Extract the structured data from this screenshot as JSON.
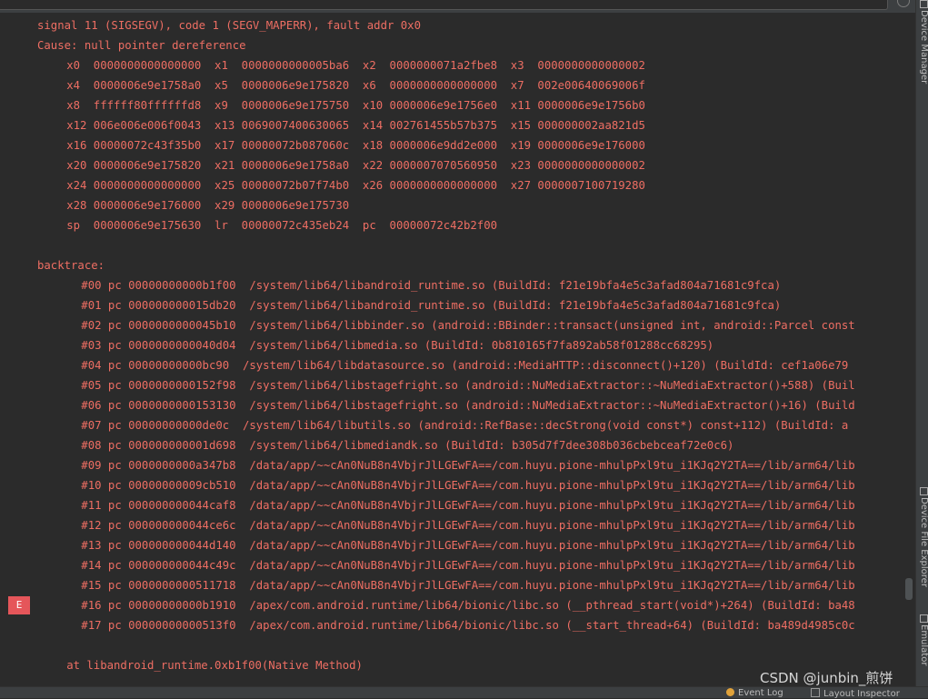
{
  "colors": {
    "log_error": "#ee6e63",
    "background": "#2b2b2b",
    "panel": "#3c3f41",
    "badge": "#e5565a"
  },
  "log_lines": [
    {
      "indent": 0,
      "text": "signal 11 (SIGSEGV), code 1 (SEGV_MAPERR), fault addr 0x0"
    },
    {
      "indent": 0,
      "text": "Cause: null pointer dereference"
    },
    {
      "indent": 4,
      "text": "x0  0000000000000000  x1  0000000000005ba6  x2  0000000071a2fbe8  x3  0000000000000002"
    },
    {
      "indent": 4,
      "text": "x4  0000006e9e1758a0  x5  0000006e9e175820  x6  0000000000000000  x7  002e00640069006f"
    },
    {
      "indent": 4,
      "text": "x8  ffffff80ffffffd8  x9  0000006e9e175750  x10 0000006e9e1756e0  x11 0000006e9e1756b0"
    },
    {
      "indent": 4,
      "text": "x12 006e006e006f0043  x13 0069007400630065  x14 002761455b57b375  x15 000000002aa821d5"
    },
    {
      "indent": 4,
      "text": "x16 00000072c43f35b0  x17 00000072b087060c  x18 0000006e9dd2e000  x19 0000006e9e176000"
    },
    {
      "indent": 4,
      "text": "x20 0000006e9e175820  x21 0000006e9e1758a0  x22 0000007070560950  x23 0000000000000002"
    },
    {
      "indent": 4,
      "text": "x24 0000000000000000  x25 00000072b07f74b0  x26 0000000000000000  x27 0000007100719280"
    },
    {
      "indent": 4,
      "text": "x28 0000006e9e176000  x29 0000006e9e175730"
    },
    {
      "indent": 4,
      "text": "sp  0000006e9e175630  lr  00000072c435eb24  pc  00000072c42b2f00"
    },
    {
      "indent": 0,
      "text": ""
    },
    {
      "indent": 0,
      "text": "backtrace:"
    },
    {
      "indent": 6,
      "text": "#00 pc 00000000000b1f00  /system/lib64/libandroid_runtime.so (BuildId: f21e19bfa4e5c3afad804a71681c9fca)"
    },
    {
      "indent": 6,
      "text": "#01 pc 000000000015db20  /system/lib64/libandroid_runtime.so (BuildId: f21e19bfa4e5c3afad804a71681c9fca)"
    },
    {
      "indent": 6,
      "text": "#02 pc 0000000000045b10  /system/lib64/libbinder.so (android::BBinder::transact(unsigned int, android::Parcel const"
    },
    {
      "indent": 6,
      "text": "#03 pc 0000000000040d04  /system/lib64/libmedia.so (BuildId: 0b810165f7fa892ab58f01288cc68295)"
    },
    {
      "indent": 6,
      "text": "#04 pc 00000000000bc90  /system/lib64/libdatasource.so (android::MediaHTTP::disconnect()+120) (BuildId: cef1a06e79"
    },
    {
      "indent": 6,
      "text": "#05 pc 0000000000152f98  /system/lib64/libstagefright.so (android::NuMediaExtractor::~NuMediaExtractor()+588) (Buil"
    },
    {
      "indent": 6,
      "text": "#06 pc 0000000000153130  /system/lib64/libstagefright.so (android::NuMediaExtractor::~NuMediaExtractor()+16) (Build"
    },
    {
      "indent": 6,
      "text": "#07 pc 00000000000de0c  /system/lib64/libutils.so (android::RefBase::decStrong(void const*) const+112) (BuildId: a"
    },
    {
      "indent": 6,
      "text": "#08 pc 000000000001d698  /system/lib64/libmediandk.so (BuildId: b305d7f7dee308b036cbebceaf72e0c6)"
    },
    {
      "indent": 6,
      "text": "#09 pc 0000000000a347b8  /data/app/~~cAn0NuB8n4VbjrJlLGEwFA==/com.huyu.pione-mhulpPxl9tu_i1KJq2Y2TA==/lib/arm64/lib"
    },
    {
      "indent": 6,
      "text": "#10 pc 00000000009cb510  /data/app/~~cAn0NuB8n4VbjrJlLGEwFA==/com.huyu.pione-mhulpPxl9tu_i1KJq2Y2TA==/lib/arm64/lib"
    },
    {
      "indent": 6,
      "text": "#11 pc 000000000044caf8  /data/app/~~cAn0NuB8n4VbjrJlLGEwFA==/com.huyu.pione-mhulpPxl9tu_i1KJq2Y2TA==/lib/arm64/lib"
    },
    {
      "indent": 6,
      "text": "#12 pc 000000000044ce6c  /data/app/~~cAn0NuB8n4VbjrJlLGEwFA==/com.huyu.pione-mhulpPxl9tu_i1KJq2Y2TA==/lib/arm64/lib"
    },
    {
      "indent": 6,
      "text": "#13 pc 000000000044d140  /data/app/~~cAn0NuB8n4VbjrJlLGEwFA==/com.huyu.pione-mhulpPxl9tu_i1KJq2Y2TA==/lib/arm64/lib"
    },
    {
      "indent": 6,
      "text": "#14 pc 000000000044c49c  /data/app/~~cAn0NuB8n4VbjrJlLGEwFA==/com.huyu.pione-mhulpPxl9tu_i1KJq2Y2TA==/lib/arm64/lib"
    },
    {
      "indent": 6,
      "text": "#15 pc 0000000000511718  /data/app/~~cAn0NuB8n4VbjrJlLGEwFA==/com.huyu.pione-mhulpPxl9tu_i1KJq2Y2TA==/lib/arm64/lib"
    },
    {
      "indent": 6,
      "text": "#16 pc 00000000000b1910  /apex/com.android.runtime/lib64/bionic/libc.so (__pthread_start(void*)+264) (BuildId: ba48"
    },
    {
      "indent": 6,
      "text": "#17 pc 00000000000513f0  /apex/com.android.runtime/lib64/bionic/libc.so (__start_thread+64) (BuildId: ba489d4985c0c"
    },
    {
      "indent": 0,
      "text": ""
    },
    {
      "indent": 4,
      "text": "at libandroid_runtime.0xb1f00(Native Method)"
    }
  ],
  "gutter": {
    "level_badge": "E"
  },
  "right_tool_windows": [
    {
      "label": "Device Manager",
      "icon": "device-manager-icon"
    },
    {
      "label": "Device File Explorer",
      "icon": "folder-icon"
    },
    {
      "label": "Emulator",
      "icon": "emulator-icon"
    }
  ],
  "bottom_tools": {
    "event_log": {
      "label": "Event Log",
      "icon": "event-log-icon"
    },
    "layout_inspector": {
      "label": "Layout Inspector",
      "icon": "layout-inspector-icon"
    }
  },
  "watermark": "CSDN @junbin_煎饼"
}
